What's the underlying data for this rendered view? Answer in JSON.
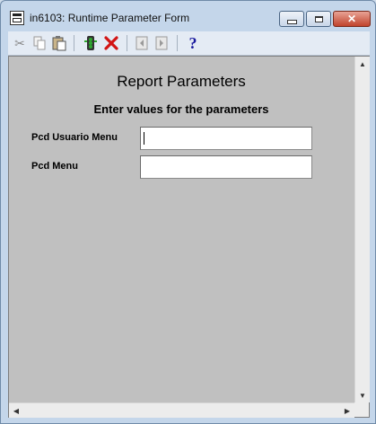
{
  "window": {
    "title": "in6103: Runtime Parameter Form"
  },
  "toolbar": {
    "icons": [
      "scissors-icon",
      "copy-icon",
      "paste-icon",
      "traffic-light-icon",
      "delete-x-icon",
      "first-page-icon",
      "prev-page-icon",
      "help-icon"
    ],
    "help_glyph": "?"
  },
  "form": {
    "title": "Report Parameters",
    "subtitle": "Enter values for the parameters",
    "fields": [
      {
        "label": "Pcd Usuario Menu",
        "value": ""
      },
      {
        "label": "Pcd Menu",
        "value": ""
      }
    ]
  }
}
